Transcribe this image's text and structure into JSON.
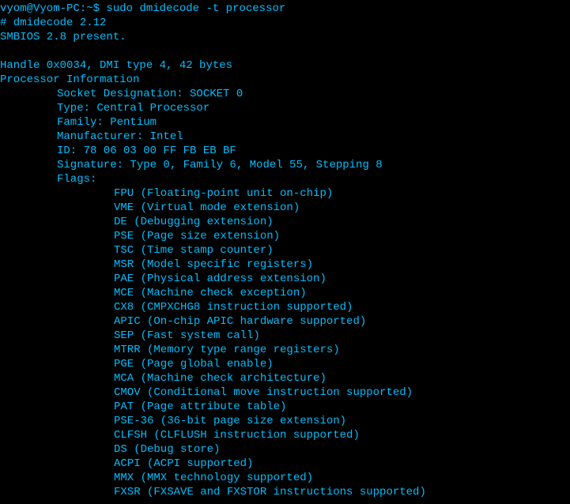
{
  "prompt": {
    "user_host": "vyom@Vyom-PC",
    "separator": ":",
    "path": "~$",
    "command": "sudo dmidecode -t processor"
  },
  "header": {
    "version": "# dmidecode 2.12",
    "smbios": "SMBIOS 2.8 present."
  },
  "handle": "Handle 0x0034, DMI type 4, 42 bytes",
  "section": "Processor Information",
  "fields": {
    "socket": "Socket Designation: SOCKET 0",
    "type": "Type: Central Processor",
    "family": "Family: Pentium",
    "manufacturer": "Manufacturer: Intel",
    "id": "ID: 78 06 03 00 FF FB EB BF",
    "signature": "Signature: Type 0, Family 6, Model 55, Stepping 8",
    "flags_label": "Flags:"
  },
  "flags": [
    "FPU (Floating-point unit on-chip)",
    "VME (Virtual mode extension)",
    "DE (Debugging extension)",
    "PSE (Page size extension)",
    "TSC (Time stamp counter)",
    "MSR (Model specific registers)",
    "PAE (Physical address extension)",
    "MCE (Machine check exception)",
    "CX8 (CMPXCHG8 instruction supported)",
    "APIC (On-chip APIC hardware supported)",
    "SEP (Fast system call)",
    "MTRR (Memory type range registers)",
    "PGE (Page global enable)",
    "MCA (Machine check architecture)",
    "CMOV (Conditional move instruction supported)",
    "PAT (Page attribute table)",
    "PSE-36 (36-bit page size extension)",
    "CLFSH (CLFLUSH instruction supported)",
    "DS (Debug store)",
    "ACPI (ACPI supported)",
    "MMX (MMX technology supported)",
    "FXSR (FXSAVE and FXSTOR instructions supported)"
  ]
}
